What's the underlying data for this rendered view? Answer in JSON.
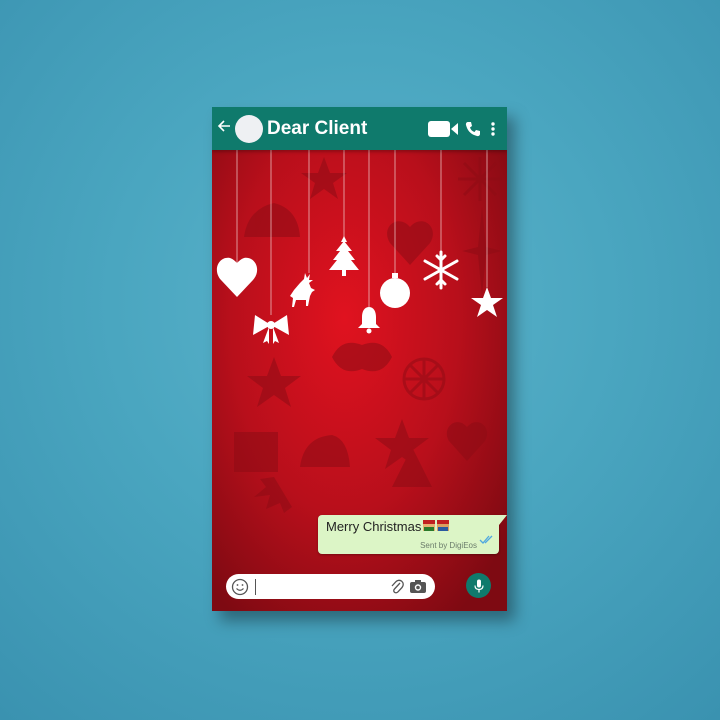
{
  "header": {
    "contact_name": "Dear Client",
    "icons": [
      "back-arrow-icon",
      "avatar",
      "video-call-icon",
      "phone-icon",
      "more-options-icon"
    ]
  },
  "message": {
    "text": "Merry Christmas",
    "signature": "Sent by DigiEos",
    "status_icon": "double-check-icon",
    "emoji": "christmas-characters-emoji"
  },
  "composer": {
    "value": "",
    "icons": [
      "emoji-icon",
      "attach-icon",
      "camera-icon",
      "mic-icon"
    ]
  },
  "wallpaper": {
    "ornaments": [
      "heart",
      "bow",
      "reindeer",
      "christmas-tree",
      "bell",
      "bauble",
      "snowflake",
      "star"
    ]
  },
  "colors": {
    "accent": "#0f7a6c",
    "bubble": "#dcf5c6",
    "wallpaper": "#b3101a",
    "background": "#4aa6c0"
  }
}
